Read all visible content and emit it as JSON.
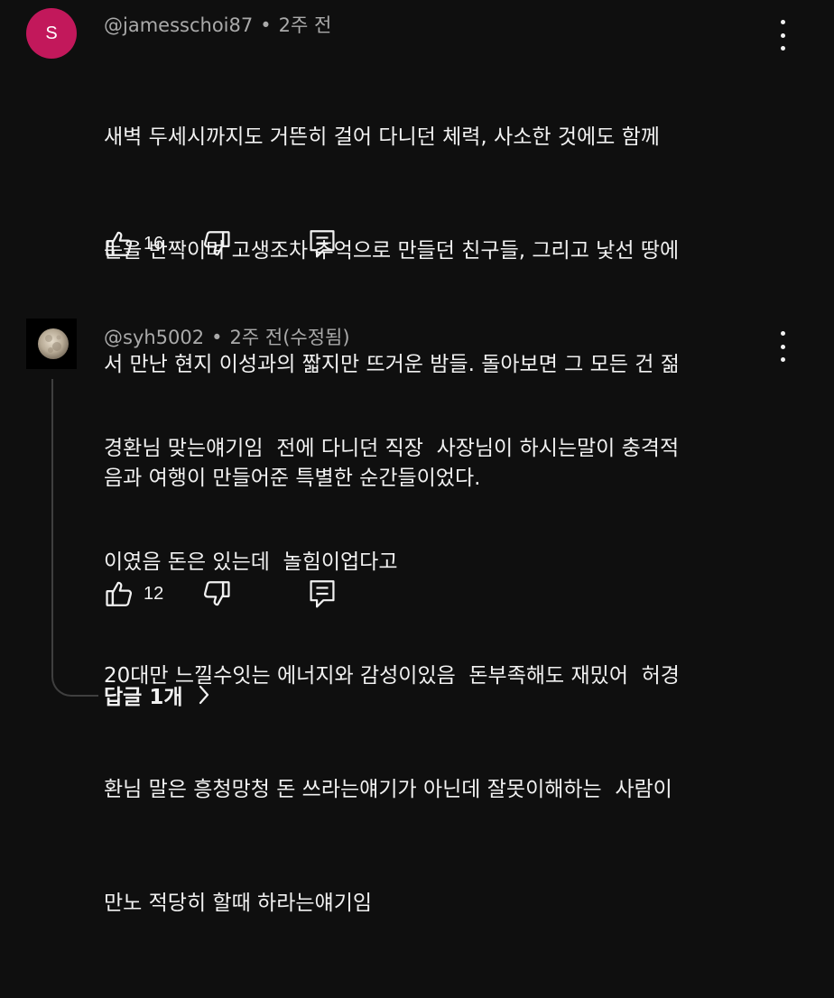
{
  "comments": [
    {
      "avatar_letter": "S",
      "avatar_color": "#c2185b",
      "author": "@jamesschoi87",
      "separator": "•",
      "time": "2주 전",
      "lines": [
        "새벽 두세시까지도 거뜬히 걸어 다니던 체력, 사소한 것에도 함께",
        "눈을 반짝이며 고생조차 추억으로 만들던 친구들, 그리고 낯선 땅에",
        "서 만난 현지 이성과의 짧지만 뜨거운 밤들. 돌아보면 그 모든 건 젊",
        "음과 여행이 만들어준 특별한 순간들이었다."
      ],
      "likes": "16",
      "icons": {
        "like": "thumbs-up-icon",
        "dislike": "thumbs-down-icon",
        "reply": "reply-comment-icon",
        "more": "more-vertical-icon"
      }
    },
    {
      "avatar_image": "moon",
      "author": "@syh5002",
      "separator": "•",
      "time": "2주 전(수정됨)",
      "lines": [
        "경환님 맞는얘기임  전에 다니던 직장  사장님이 하시는말이 충격적",
        "이였음 돈은 있는데  놀힘이업다고",
        "20대만 느낄수잇는 에너지와 감성이있음  돈부족해도 재밌어  허경",
        "환님 말은 흥청망청 돈 쓰라는얘기가 아닌데 잘못이해하는  사람이",
        "만노 적당히 할때 하라는얘기임"
      ],
      "likes": "12",
      "icons": {
        "like": "thumbs-up-icon",
        "dislike": "thumbs-down-icon",
        "reply": "reply-comment-icon",
        "more": "more-vertical-icon"
      }
    }
  ],
  "replies_toggle": {
    "label": "답글 1개",
    "icon": "chevron-right-icon"
  }
}
